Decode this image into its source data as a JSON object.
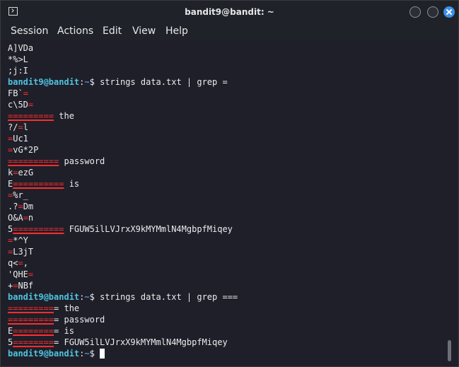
{
  "window": {
    "title": "bandit9@bandit: ~"
  },
  "menu": [
    "Session",
    "Actions",
    "Edit",
    "View",
    "Help"
  ],
  "prompt": {
    "user": "bandit9@bandit",
    "path": "~"
  },
  "terminal_lines": [
    [
      {
        "t": "A]VDa"
      }
    ],
    [
      {
        "t": "*%>L"
      }
    ],
    [
      {
        "t": ";j:I"
      }
    ],
    [
      {
        "t": "bandit9@bandit",
        "c": "user"
      },
      {
        "t": ":"
      },
      {
        "t": "~",
        "c": "path"
      },
      {
        "t": "$ strings data.txt | grep ="
      }
    ],
    [
      {
        "t": "FB`"
      },
      {
        "t": "=",
        "c": "hl"
      }
    ],
    [
      {
        "t": "c\\5D"
      },
      {
        "t": "=",
        "c": "hl"
      }
    ],
    [
      {
        "t": "=========",
        "c": "hl-u"
      },
      {
        "t": " the"
      }
    ],
    [
      {
        "t": "?/"
      },
      {
        "t": "=",
        "c": "hl"
      },
      {
        "t": "l"
      }
    ],
    [
      {
        "t": "=",
        "c": "hl"
      },
      {
        "t": "Uc1"
      }
    ],
    [
      {
        "t": "=",
        "c": "hl"
      },
      {
        "t": "vG*2P"
      }
    ],
    [
      {
        "t": "==========",
        "c": "hl-u"
      },
      {
        "t": " password"
      }
    ],
    [
      {
        "t": "k"
      },
      {
        "t": "=",
        "c": "hl"
      },
      {
        "t": "ezG"
      }
    ],
    [
      {
        "t": "E"
      },
      {
        "t": "==========",
        "c": "hl-u"
      },
      {
        "t": " is"
      }
    ],
    [
      {
        "t": "=",
        "c": "hl"
      },
      {
        "t": "%r_"
      }
    ],
    [
      {
        "t": ".?"
      },
      {
        "t": "=",
        "c": "hl"
      },
      {
        "t": "Dm"
      }
    ],
    [
      {
        "t": "O&A"
      },
      {
        "t": "=",
        "c": "hl"
      },
      {
        "t": "n"
      }
    ],
    [
      {
        "t": "5"
      },
      {
        "t": "==========",
        "c": "hl-u"
      },
      {
        "t": " FGUW5ilLVJrxX9kMYMmlN4MgbpfMiqey"
      }
    ],
    [
      {
        "t": "=",
        "c": "hl"
      },
      {
        "t": "*^Y"
      }
    ],
    [
      {
        "t": "=",
        "c": "hl"
      },
      {
        "t": "L3jT"
      }
    ],
    [
      {
        "t": "q<"
      },
      {
        "t": "=",
        "c": "hl"
      },
      {
        "t": ","
      }
    ],
    [
      {
        "t": "'QHE"
      },
      {
        "t": "=",
        "c": "hl"
      }
    ],
    [
      {
        "t": "+"
      },
      {
        "t": "=",
        "c": "hl"
      },
      {
        "t": "NBf"
      }
    ],
    [
      {
        "t": "bandit9@bandit",
        "c": "user"
      },
      {
        "t": ":"
      },
      {
        "t": "~",
        "c": "path"
      },
      {
        "t": "$ strings data.txt | grep ==="
      }
    ],
    [
      {
        "t": "=========",
        "c": "hl-u"
      },
      {
        "t": "= the"
      }
    ],
    [
      {
        "t": "=========",
        "c": "hl-u"
      },
      {
        "t": "= password"
      }
    ],
    [
      {
        "t": "E"
      },
      {
        "t": "========",
        "c": "hl-u"
      },
      {
        "t": "= is"
      }
    ],
    [
      {
        "t": "5"
      },
      {
        "t": "========",
        "c": "hl-u"
      },
      {
        "t": "= FGUW5ilLVJrxX9kMYMmlN4MgbpfMiqey"
      }
    ],
    [
      {
        "t": "bandit9@bandit",
        "c": "user"
      },
      {
        "t": ":"
      },
      {
        "t": "~",
        "c": "path"
      },
      {
        "t": "$ "
      }
    ]
  ],
  "colors": {
    "prompt_user": "#4fc3e0",
    "prompt_path": "#5b8dd6",
    "match_highlight": "#ff2d2d",
    "terminal_bg": "#1e1f29",
    "close_button": "#3d8fe8"
  }
}
